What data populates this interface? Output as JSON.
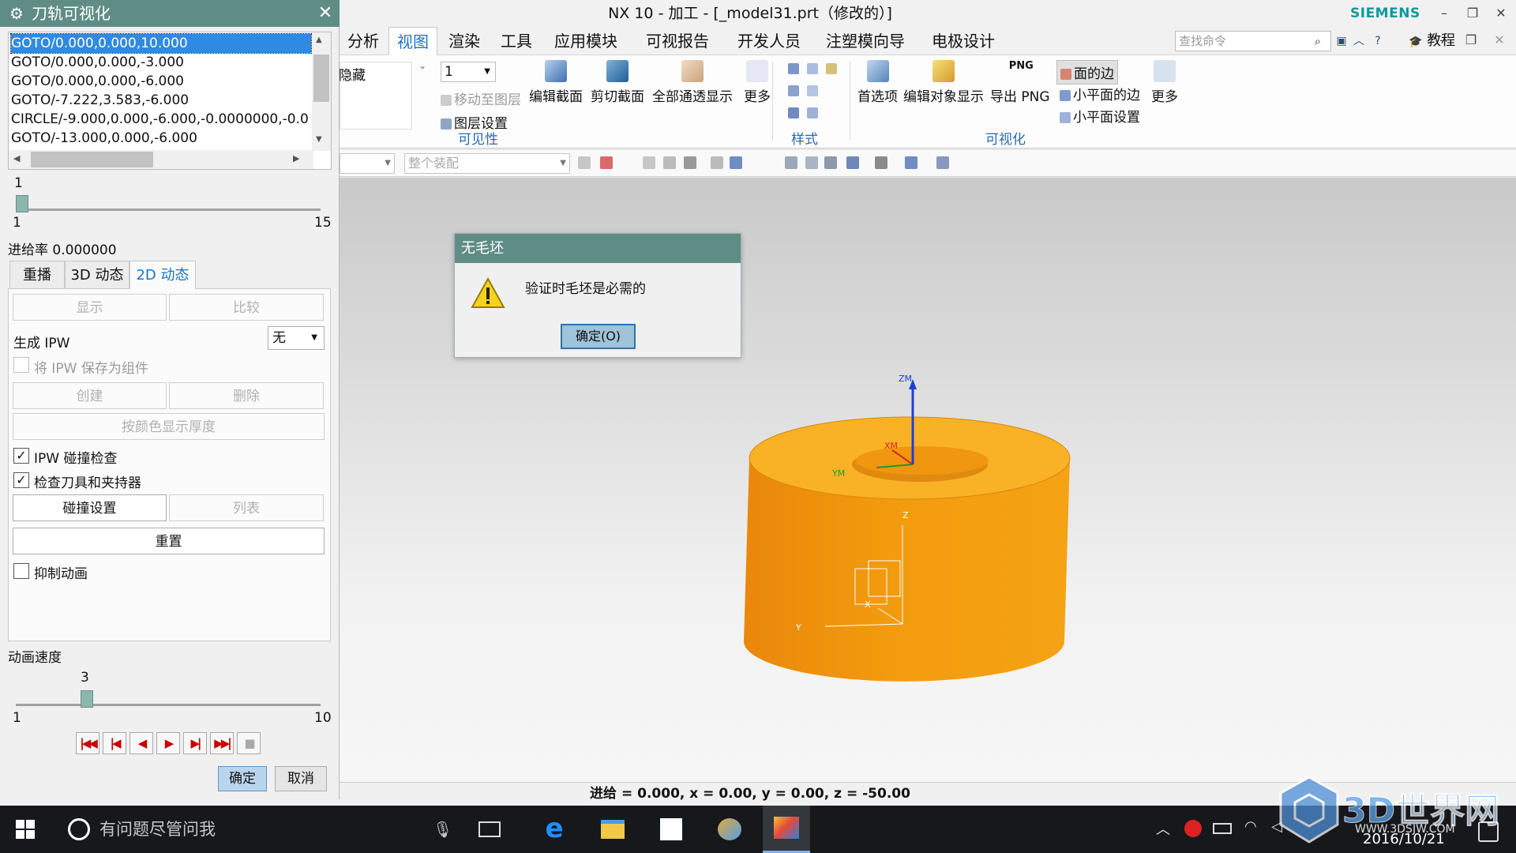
{
  "window": {
    "title": "NX 10 - 加工 - [_model31.prt（修改的）]",
    "brand": "SIEMENS",
    "min": "–",
    "restore": "❐",
    "close": "✕"
  },
  "menubar": {
    "items": [
      "分析",
      "视图",
      "渲染",
      "工具",
      "应用模块",
      "可视报告",
      "开发人员",
      "注塑模向导",
      "电极设计"
    ],
    "active": "视图",
    "search_placeholder": "查找命令",
    "tutorial": "教程"
  },
  "ribbon": {
    "hide_label": "隐藏",
    "layer_value": "1",
    "move_to_layer": "移动至图层",
    "layer_settings": "图层设置",
    "visibility_group": "可见性",
    "buttons": [
      "编辑截面",
      "剪切截面",
      "全部通透显示",
      "更多"
    ],
    "style_group": "样式",
    "vis_buttons": [
      "首选项",
      "编辑对象显示",
      "导出 PNG"
    ],
    "png_tag": "PNG",
    "face_edges": "面的边",
    "facet_edges": "小平面的边",
    "facet_settings": "小平面设置",
    "more2": "更多",
    "visualization_group": "可视化"
  },
  "toolbar2": {
    "filter_combo": "",
    "assembly_combo": "整个装配"
  },
  "dialog": {
    "title": "无毛坯",
    "message": "验证时毛坯是必需的",
    "ok": "确定(O)"
  },
  "panel": {
    "title": "刀轨可视化",
    "gotos": [
      "GOTO/0.000,0.000,10.000",
      "GOTO/0.000,0.000,-3.000",
      "GOTO/0.000,0.000,-6.000",
      "GOTO/-7.222,3.583,-6.000",
      "CIRCLE/-9.000,0.000,-6.000,-0.0000000,-0.0",
      "GOTO/-13.000,0.000,-6.000"
    ],
    "slider1": {
      "value": "1",
      "min": "1",
      "max": "15",
      "position": 0
    },
    "feed_rate": "进给率 0.000000",
    "tabs": [
      "重播",
      "3D 动态",
      "2D 动态"
    ],
    "active_tab": "2D 动态",
    "show": "显示",
    "compare": "比较",
    "gen_ipw": "生成 IPW",
    "ipw_value": "无",
    "save_ipw": "将 IPW 保存为组件",
    "create": "创建",
    "delete": "删除",
    "thickness": "按颜色显示厚度",
    "ipw_collision": "IPW 碰撞检查",
    "ipw_collision_checked": true,
    "check_tools": "检查刀具和夹持器",
    "check_tools_checked": true,
    "collision_settings": "碰撞设置",
    "list": "列表",
    "reset": "重置",
    "suppress": "抑制动画",
    "suppress_checked": false,
    "speed_label": "动画速度",
    "speed": {
      "value": "3",
      "min": "1",
      "max": "10",
      "position": 0.222
    },
    "ok": "确定",
    "cancel": "取消"
  },
  "viewport": {
    "axis_labels": {
      "zm": "ZM",
      "xm": "XM",
      "ym": "YM",
      "z": "Z",
      "x": "X",
      "y": "Y"
    },
    "part_color": "#f0920a"
  },
  "status": {
    "text": "进给 = 0.000, x = 0.00, y = 0.00, z = -50.00"
  },
  "taskbar": {
    "search": "有问题尽管问我",
    "date": "2016/10/21",
    "watermark": "3D世界网",
    "watermark_url": "WWW.3DSJW.COM"
  }
}
